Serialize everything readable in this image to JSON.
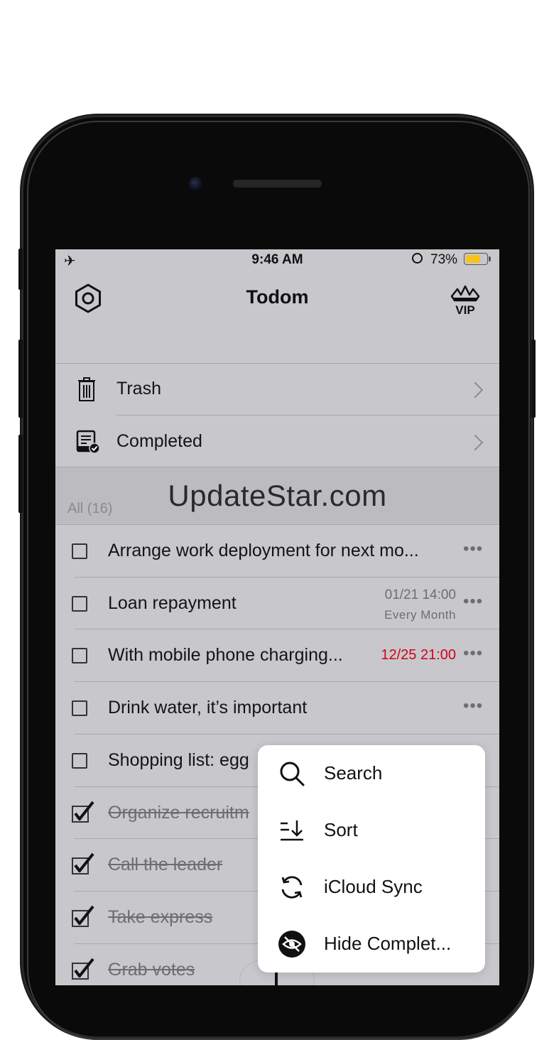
{
  "status_bar": {
    "time": "9:46 AM",
    "battery_percent": "73%",
    "battery_level": 0.73,
    "battery_color": "#f5c31a",
    "icons": [
      "airplane-icon",
      "orientation-lock-icon",
      "battery-icon"
    ]
  },
  "navbar": {
    "title": "Todom",
    "left_icon": "settings-hexagon-icon",
    "right_icon": "vip-crown-icon",
    "vip_label": "VIP"
  },
  "folders": [
    {
      "label": "Trash",
      "icon": "trash-icon"
    },
    {
      "label": "Completed",
      "icon": "completed-clipboard-icon"
    }
  ],
  "section": {
    "header": "All (16)",
    "watermark": "UpdateStar.com"
  },
  "todos": [
    {
      "text": "Arrange work deployment for next mo...",
      "done": false
    },
    {
      "text": "Loan repayment",
      "done": false,
      "date": "01/21 14:00",
      "repeat": "Every Month"
    },
    {
      "text": "With mobile phone charging...",
      "done": false,
      "date_overdue": "12/25 21:00",
      "overdue_color": "#d0021b"
    },
    {
      "text": "Drink water, it’s important",
      "done": false
    },
    {
      "text": "Shopping list: egg",
      "done": false
    },
    {
      "text": "Organize recruitm",
      "done": true
    },
    {
      "text": "Call the leader",
      "done": true
    },
    {
      "text": "Take express",
      "done": true
    },
    {
      "text": "Grab votes",
      "done": true
    }
  ],
  "more_glyph": "•••",
  "menu": {
    "items": [
      {
        "label": "Search",
        "icon": "search-icon"
      },
      {
        "label": "Sort",
        "icon": "sort-icon"
      },
      {
        "label": "iCloud Sync",
        "icon": "sync-icon"
      },
      {
        "label": "Hide Complet...",
        "icon": "hide-eye-icon"
      }
    ]
  }
}
